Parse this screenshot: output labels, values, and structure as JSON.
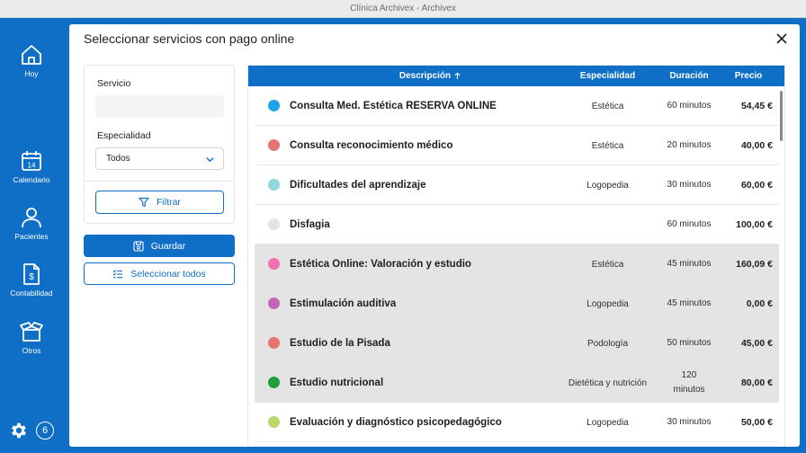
{
  "window": {
    "title": "Clínica Archivex - Archivex"
  },
  "sidebar": {
    "items": [
      {
        "label": "Hoy",
        "icon": "home-icon"
      },
      {
        "label": "Calendario",
        "icon": "calendar-icon",
        "day": "14"
      },
      {
        "label": "Pacientes",
        "icon": "user-icon"
      },
      {
        "label": "Contabilidad",
        "icon": "invoice-dollar-icon"
      },
      {
        "label": "Otros",
        "icon": "box-icon"
      }
    ],
    "settings_icon": "gear-icon",
    "badge_count": "6"
  },
  "modal": {
    "title": "Seleccionar servicios con pago online",
    "close_icon": "close-icon"
  },
  "filters": {
    "service_label": "Servicio",
    "service_value": "",
    "specialty_label": "Especialidad",
    "specialty_value": "Todos",
    "filter_button": "Filtrar"
  },
  "actions": {
    "save": "Guardar",
    "select_all": "Seleccionar todos"
  },
  "table": {
    "columns": {
      "description": "Descripción",
      "specialty": "Especialidad",
      "duration": "Duración",
      "price": "Precio"
    },
    "sort_icon": "arrow-up-icon",
    "rows": [
      {
        "color": "#1ea3e8",
        "description": "Consulta Med. Estética RESERVA ONLINE",
        "specialty": "Estética",
        "duration": "60 minutos",
        "price": "54,45 €",
        "selected": false
      },
      {
        "color": "#e57373",
        "description": "Consulta reconocimiento médico",
        "specialty": "Estética",
        "duration": "20 minutos",
        "price": "40,00 €",
        "selected": false
      },
      {
        "color": "#8fd8e0",
        "description": "Dificultades del aprendizaje",
        "specialty": "Logopedia",
        "duration": "30 minutos",
        "price": "60,00 €",
        "selected": false
      },
      {
        "color": "#e4e4e4",
        "description": "Disfagia",
        "specialty": "",
        "duration": "60 minutos",
        "price": "100,00 €",
        "selected": false
      },
      {
        "color": "#f26fb0",
        "description": "Estética Online: Valoración y estudio",
        "specialty": "Estética",
        "duration": "45 minutos",
        "price": "160,09 €",
        "selected": true
      },
      {
        "color": "#c065b8",
        "description": "Estimulación auditiva",
        "specialty": "Logopedia",
        "duration": "45 minutos",
        "price": "0,00 €",
        "selected": true
      },
      {
        "color": "#e57373",
        "description": "Estudio de la Pisada",
        "specialty": "Podología",
        "duration": "50 minutos",
        "price": "45,00 €",
        "selected": true
      },
      {
        "color": "#1e9e3e",
        "description": "Estudio nutricional",
        "specialty": "Dietética y nutrición",
        "duration": "120 minutos",
        "price": "80,00 €",
        "selected": true
      },
      {
        "color": "#b9d96a",
        "description": "Evaluación y diagnóstico psicopedagógico",
        "specialty": "Logopedia",
        "duration": "30 minutos",
        "price": "50,00 €",
        "selected": false
      }
    ]
  },
  "colors": {
    "primary": "#0f6fc6",
    "selected_row": "#e4e4e4"
  }
}
